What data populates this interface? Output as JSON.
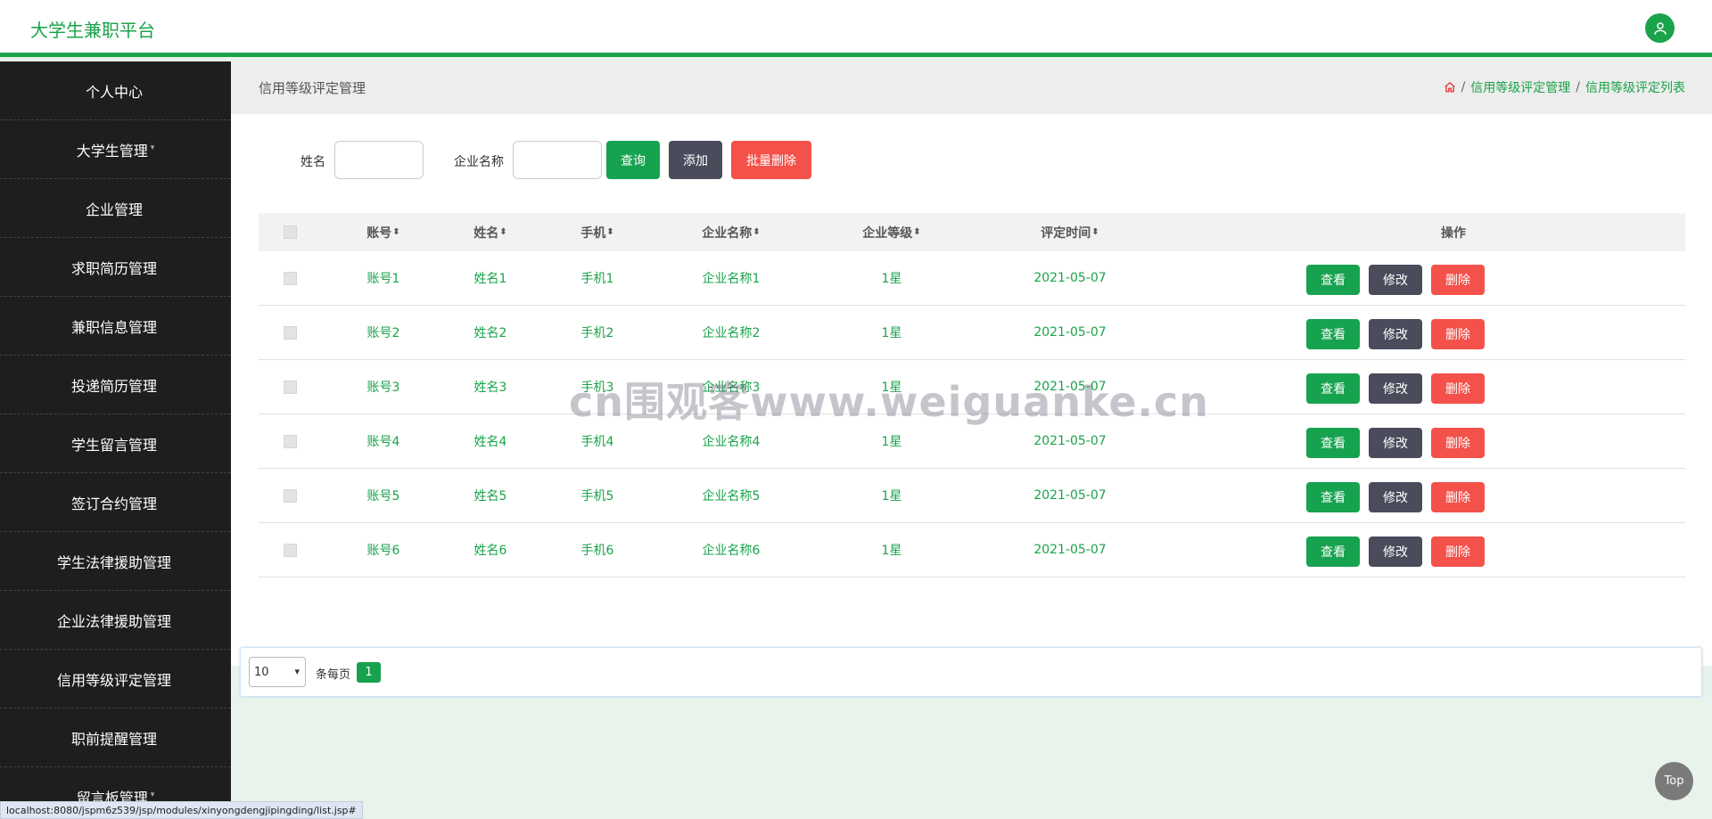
{
  "header": {
    "brand": "大学生兼职平台",
    "avatar_icon": "user-icon"
  },
  "sidebar": {
    "items": [
      {
        "label": "个人中心",
        "caret": ""
      },
      {
        "label": "大学生管理",
        "caret": "▾"
      },
      {
        "label": "企业管理",
        "caret": ""
      },
      {
        "label": "求职简历管理",
        "caret": ""
      },
      {
        "label": "兼职信息管理",
        "caret": ""
      },
      {
        "label": "投递简历管理",
        "caret": ""
      },
      {
        "label": "学生留言管理",
        "caret": ""
      },
      {
        "label": "签订合约管理",
        "caret": ""
      },
      {
        "label": "学生法律援助管理",
        "caret": ""
      },
      {
        "label": "企业法律援助管理",
        "caret": ""
      },
      {
        "label": "信用等级评定管理",
        "caret": ""
      },
      {
        "label": "职前提醒管理",
        "caret": ""
      },
      {
        "label": "留言板管理",
        "caret": "▾"
      }
    ]
  },
  "page": {
    "title": "信用等级评定管理",
    "breadcrumb": {
      "home_icon": "home-icon",
      "sep": "/",
      "level1": "信用等级评定管理",
      "level2": "信用等级评定列表"
    }
  },
  "search": {
    "name_label": "姓名",
    "name_value": "",
    "company_label": "企业名称",
    "company_value": "",
    "query_label": "查询",
    "add_label": "添加",
    "batch_delete_label": "批量删除"
  },
  "table": {
    "headers": {
      "account": "账号",
      "name": "姓名",
      "phone": "手机",
      "company": "企业名称",
      "level": "企业等级",
      "date": "评定时间",
      "ops": "操作",
      "sort_icon": "⬍"
    },
    "rows": [
      {
        "account": "账号1",
        "name": "姓名1",
        "phone": "手机1",
        "company": "企业名称1",
        "level": "1星",
        "date": "2021-05-07"
      },
      {
        "account": "账号2",
        "name": "姓名2",
        "phone": "手机2",
        "company": "企业名称2",
        "level": "1星",
        "date": "2021-05-07"
      },
      {
        "account": "账号3",
        "name": "姓名3",
        "phone": "手机3",
        "company": "企业名称3",
        "level": "1星",
        "date": "2021-05-07"
      },
      {
        "account": "账号4",
        "name": "姓名4",
        "phone": "手机4",
        "company": "企业名称4",
        "level": "1星",
        "date": "2021-05-07"
      },
      {
        "account": "账号5",
        "name": "姓名5",
        "phone": "手机5",
        "company": "企业名称5",
        "level": "1星",
        "date": "2021-05-07"
      },
      {
        "account": "账号6",
        "name": "姓名6",
        "phone": "手机6",
        "company": "企业名称6",
        "level": "1星",
        "date": "2021-05-07"
      }
    ],
    "actions": {
      "view": "查看",
      "edit": "修改",
      "delete": "删除"
    }
  },
  "pagination": {
    "page_size": "10",
    "per_page_label": "条每页",
    "current_page": "1"
  },
  "watermark": "cn围观客www.weiguanke.cn",
  "top_button": "Top",
  "status_url": "localhost:8080/jspm6z539/jsp/modules/xinyongdengjipingding/list.jsp#",
  "colors": {
    "accent": "#1aa34a",
    "dark_button": "#4a4c5c",
    "danger": "#f3514a",
    "sidebar_bg": "#1e1e1e"
  }
}
